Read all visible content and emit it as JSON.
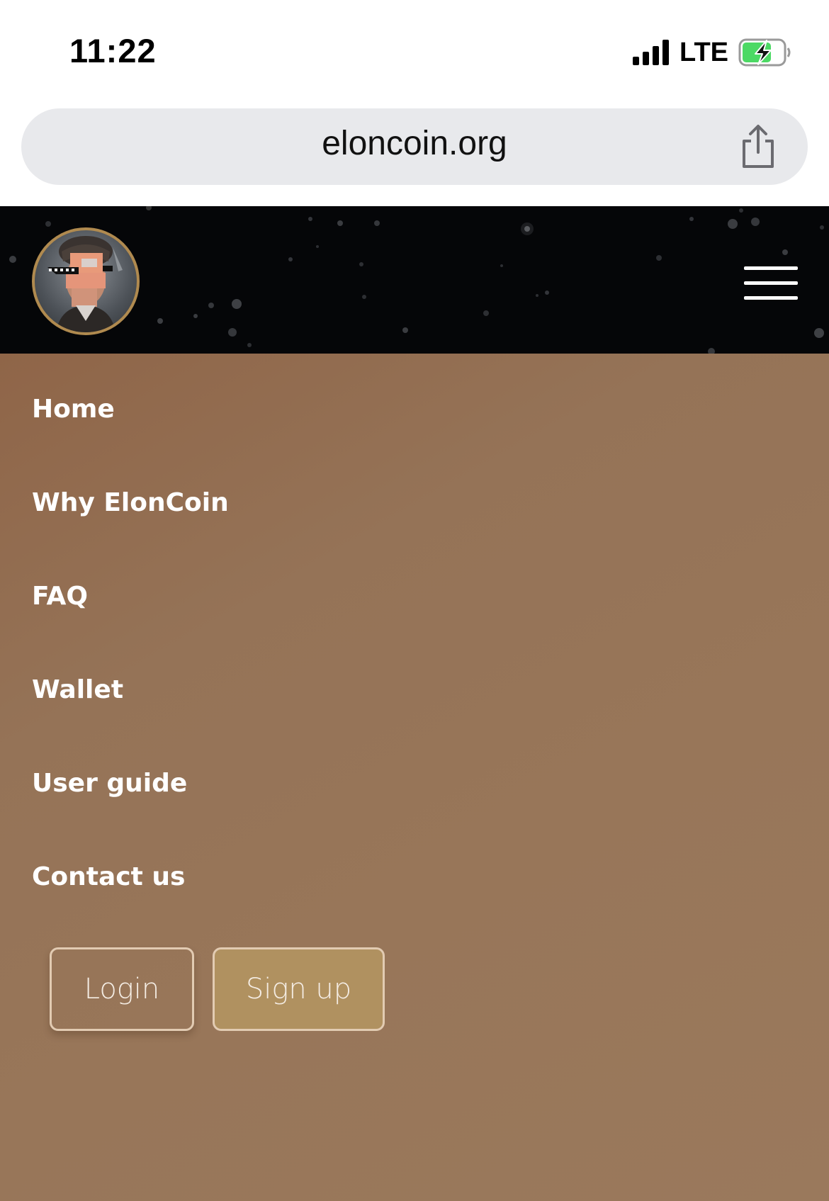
{
  "status_bar": {
    "time": "11:22",
    "network": "LTE",
    "signal_icon": "cellular-signal-icon",
    "battery_icon": "battery-charging-icon",
    "battery_color": "#4cd964"
  },
  "browser": {
    "url": "eloncoin.org",
    "share_icon": "share-icon"
  },
  "header": {
    "logo_icon": "eloncoin-logo",
    "menu_icon": "hamburger-menu-icon",
    "background_color": "#050608"
  },
  "menu": {
    "items": [
      {
        "label": "Home"
      },
      {
        "label": "Why ElonCoin"
      },
      {
        "label": "FAQ"
      },
      {
        "label": "Wallet"
      },
      {
        "label": "User guide"
      },
      {
        "label": "Contact us"
      }
    ],
    "login_label": "Login",
    "signup_label": "Sign up",
    "background_color": "#957357",
    "signup_color": "#b09160"
  }
}
